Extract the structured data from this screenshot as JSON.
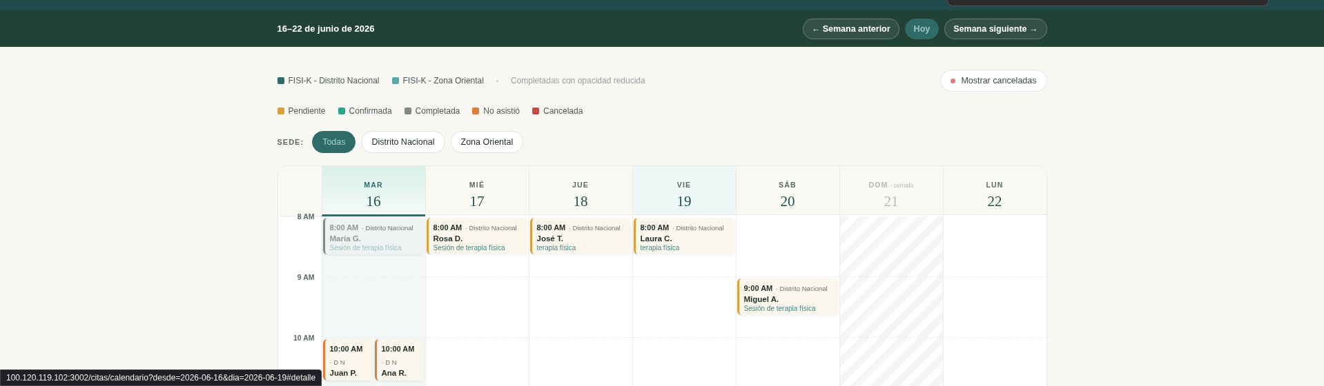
{
  "header": {
    "date_range": "16–22 de junio de 2026",
    "buttons": [
      {
        "label": "← Semana anterior",
        "disabled": false
      },
      {
        "label": "Hoy",
        "disabled": true
      },
      {
        "label": "Semana siguiente →",
        "disabled": false
      }
    ]
  },
  "legend": {
    "sedes": [
      {
        "label": "FISI-K - Distrito Nacional",
        "color": "#2f6b68"
      },
      {
        "label": "FISI-K - Zona Oriental",
        "color": "#5aa9a6"
      }
    ],
    "note": "Completadas con opacidad reducida",
    "toggle": {
      "label": "Mostrar canceladas",
      "color": "#e07b7b"
    },
    "statuses": [
      {
        "label": "Pendiente",
        "color": "#d9a13b"
      },
      {
        "label": "Confirmada",
        "color": "#2aa58a"
      },
      {
        "label": "Completada",
        "color": "#7d8a85"
      },
      {
        "label": "No asistió",
        "color": "#e07b39"
      },
      {
        "label": "Cancelada",
        "color": "#c44a48"
      }
    ]
  },
  "sede_filter": {
    "label": "SEDE:",
    "options": [
      {
        "label": "Todas",
        "selected": true
      },
      {
        "label": "Distrito Nacional",
        "selected": false
      },
      {
        "label": "Zona Oriental",
        "selected": false
      }
    ]
  },
  "calendar": {
    "days": [
      {
        "dow": "MAR",
        "num": "16",
        "today": true,
        "selected": false,
        "closed": false
      },
      {
        "dow": "MIÉ",
        "num": "17",
        "today": false,
        "selected": false,
        "closed": false
      },
      {
        "dow": "JUE",
        "num": "18",
        "today": false,
        "selected": false,
        "closed": false
      },
      {
        "dow": "VIE",
        "num": "19",
        "today": false,
        "selected": true,
        "closed": false
      },
      {
        "dow": "SÁB",
        "num": "20",
        "today": false,
        "selected": false,
        "closed": false
      },
      {
        "dow": "DOM",
        "num": "21",
        "today": false,
        "selected": false,
        "closed": true,
        "closed_label": "· cerrado"
      },
      {
        "dow": "LUN",
        "num": "22",
        "today": false,
        "selected": false,
        "closed": false
      }
    ],
    "rows": [
      {
        "label": "8 AM",
        "cells": [
          {
            "events": [
              {
                "time": "8:00 AM",
                "location": "· Distrito Nacional",
                "patient": "María G.",
                "service": "Sesión de terapia física",
                "kind": "completada"
              }
            ]
          },
          {
            "events": [
              {
                "time": "8:00 AM",
                "location": "· Distrito Nacional",
                "patient": "Rosa D.",
                "service": "Sesión de terapia física",
                "kind": "pendiente"
              }
            ]
          },
          {
            "events": [
              {
                "time": "8:00 AM",
                "location": "· Distrito Nacional",
                "patient": "José T.",
                "service": "terapia física",
                "kind": "pendiente"
              }
            ]
          },
          {
            "events": [
              {
                "time": "8:00 AM",
                "location": "· Distrito Nacional",
                "patient": "Laura C.",
                "service": "terapia física",
                "kind": "pendiente"
              }
            ]
          },
          {},
          {},
          {}
        ]
      },
      {
        "label": "9 AM",
        "cells": [
          {},
          {},
          {},
          {},
          {
            "events": [
              {
                "time": "9:00 AM",
                "location": "· Distrito Nacional",
                "patient": "Miguel A.",
                "service": "Sesión de terapia física",
                "kind": "pendiente"
              }
            ]
          },
          {},
          {}
        ]
      },
      {
        "label": "10 AM",
        "cells": [
          {
            "events": [
              {
                "time": "10:00 AM",
                "location": "· D N",
                "patient": "Juan P.",
                "kind": "no_asistio"
              },
              {
                "time": "10:00 AM",
                "location": "· D N",
                "patient": "Ana R.",
                "kind": "no_asistio"
              }
            ]
          },
          {},
          {},
          {},
          {},
          {},
          {}
        ]
      }
    ]
  },
  "status_url": "100.120.119.102:3002/citas/calendario?desde=2026-06-16&dia=2026-06-19#detalle"
}
